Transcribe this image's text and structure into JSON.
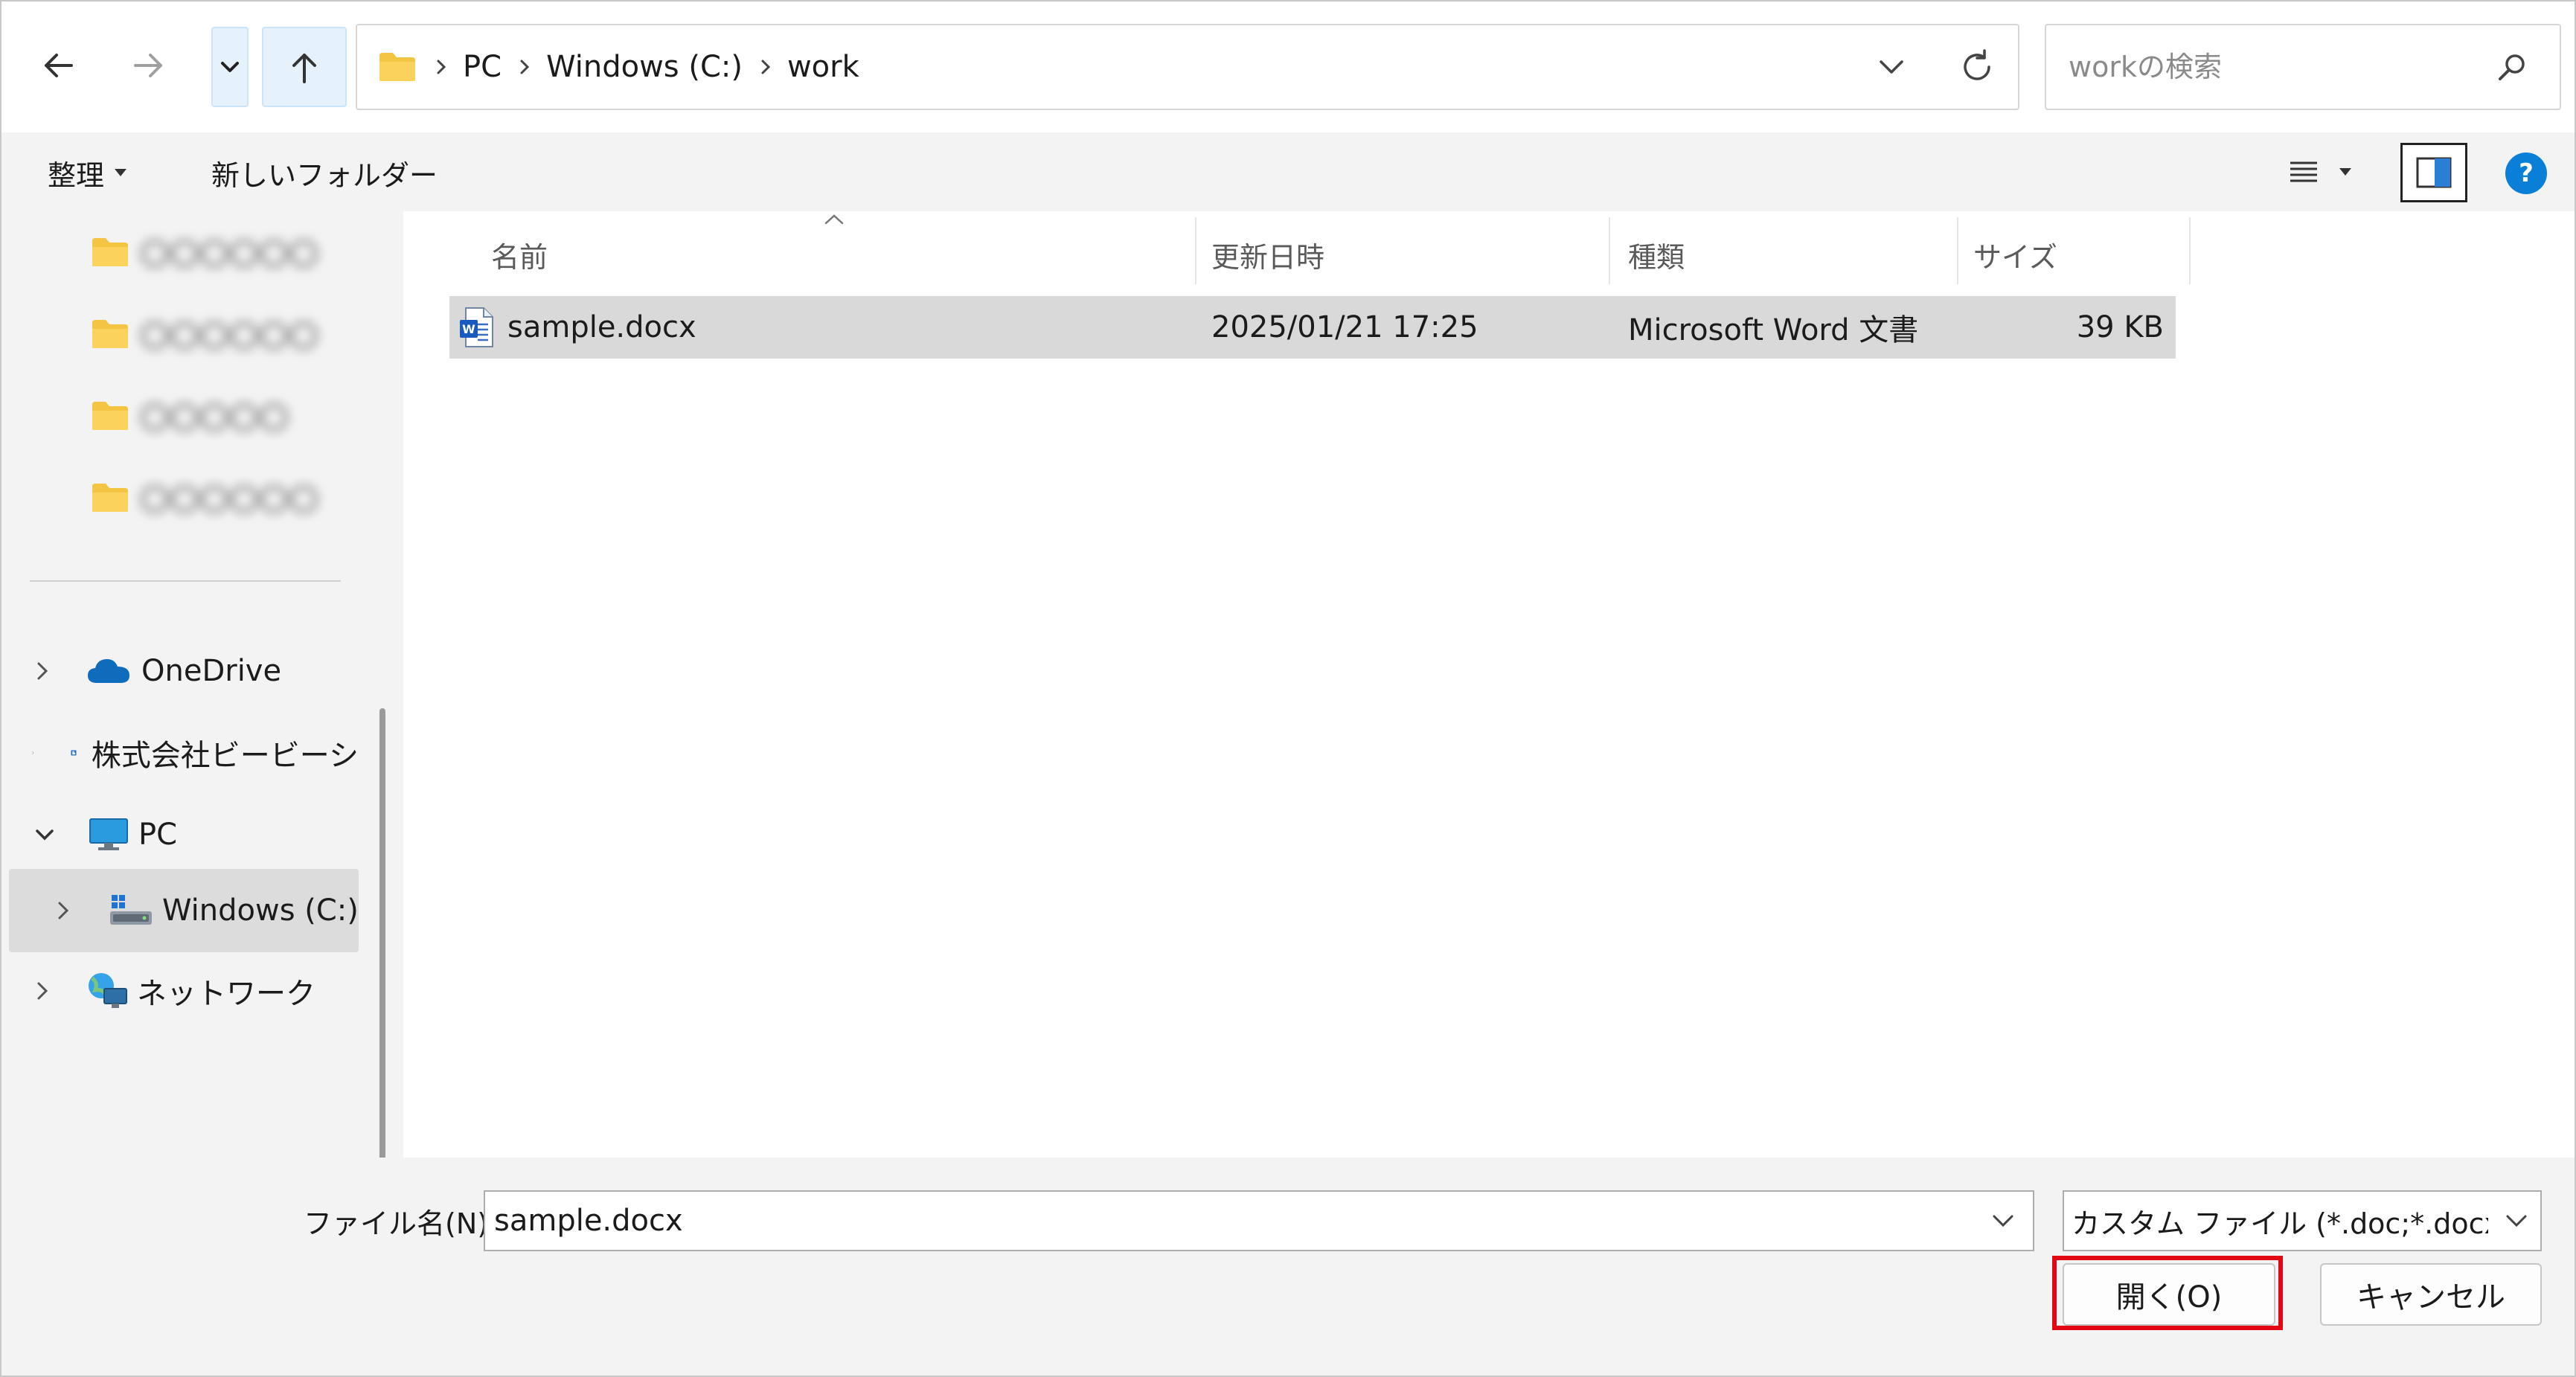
{
  "nav": {
    "back": "back",
    "forward": "forward",
    "recent": "recent-locations",
    "up": "up",
    "breadcrumb": [
      "PC",
      "Windows (C:)",
      "work"
    ],
    "search_placeholder": "workの検索"
  },
  "toolbar": {
    "organize_label": "整理",
    "new_folder_label": "新しいフォルダー"
  },
  "sidebar": {
    "blurred_folders": [
      "〇〇〇〇〇〇",
      "〇〇〇〇〇〇",
      "〇〇〇〇〇",
      "〇〇〇〇〇〇"
    ],
    "items": [
      {
        "label": "OneDrive",
        "icon": "onedrive-icon"
      },
      {
        "label": "株式会社ビービーシ",
        "icon": "org-icon"
      },
      {
        "label": "PC",
        "icon": "pc-icon"
      },
      {
        "label": "Windows (C:)",
        "icon": "drive-icon"
      },
      {
        "label": "ネットワーク",
        "icon": "network-icon"
      }
    ]
  },
  "list": {
    "columns": [
      "名前",
      "更新日時",
      "種類",
      "サイズ"
    ],
    "rows": [
      {
        "name": "sample.docx",
        "modified": "2025/01/21 17:25",
        "type": "Microsoft Word 文書",
        "size": "39 KB"
      }
    ]
  },
  "bottom": {
    "filename_label": "ファイル名(N):",
    "filename_value": "sample.docx",
    "filter_value": "カスタム ファイル (*.doc;*.docx;*.rtf;",
    "open_label": "開く(O)",
    "cancel_label": "キャンセル"
  },
  "colors": {
    "folder": "#f4c542",
    "accent": "#0078d4",
    "highlight": "#e30613",
    "selected_row": "#d9d9d9"
  }
}
